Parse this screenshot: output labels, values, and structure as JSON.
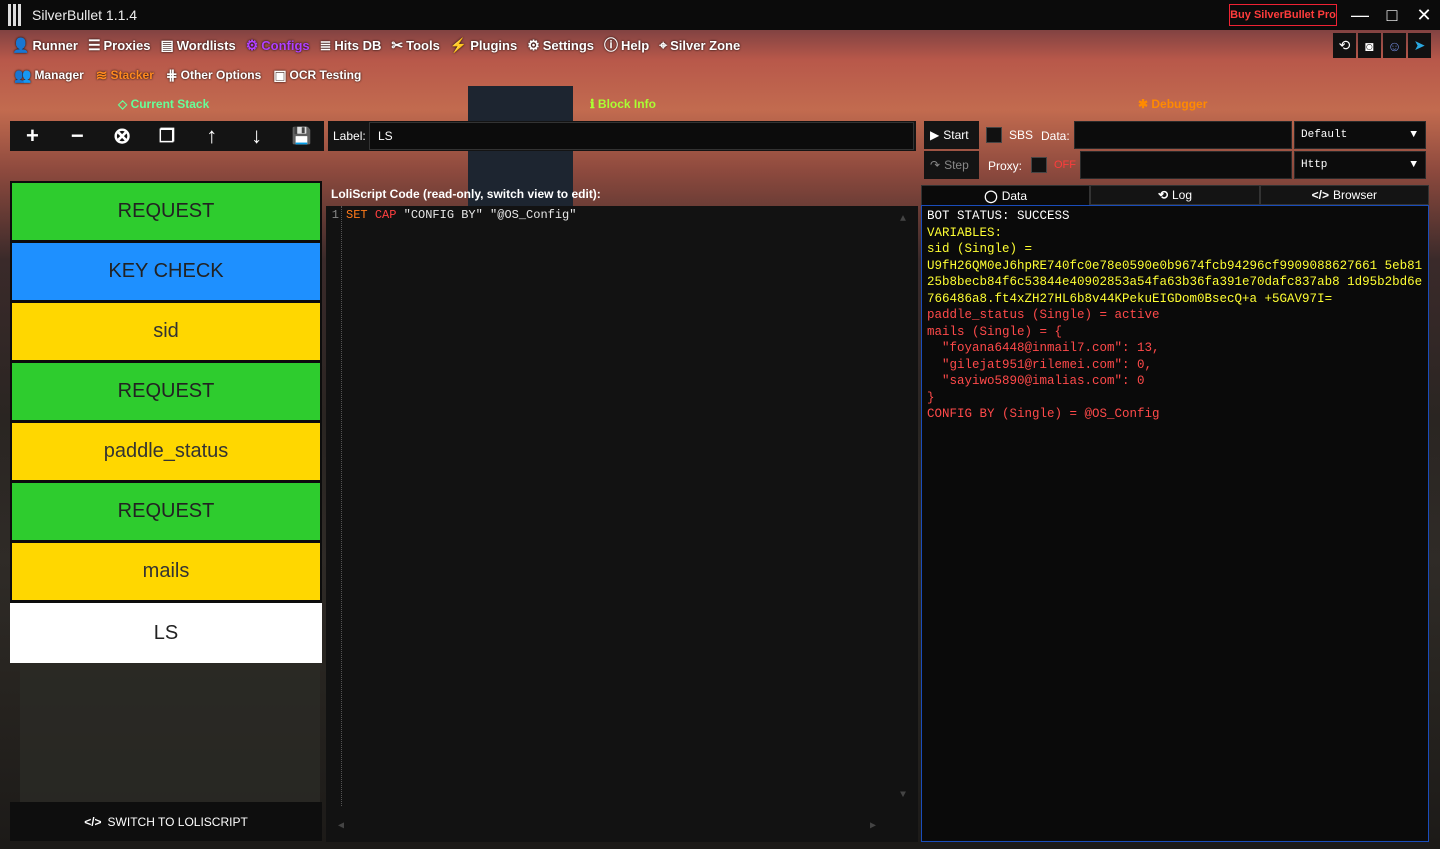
{
  "app": {
    "title": "SilverBullet 1.1.4",
    "buy_label": "Buy SilverBullet Pro"
  },
  "window_controls": {
    "minimize": "—",
    "maximize": "□",
    "close": "✕"
  },
  "nav_main": [
    {
      "label": "Runner",
      "icon": "runner-icon"
    },
    {
      "label": "Proxies",
      "icon": "server-icon"
    },
    {
      "label": "Wordlists",
      "icon": "document-icon"
    },
    {
      "label": "Configs",
      "icon": "gear-icon",
      "active": true
    },
    {
      "label": "Hits DB",
      "icon": "database-icon"
    },
    {
      "label": "Tools",
      "icon": "tools-icon"
    },
    {
      "label": "Plugins",
      "icon": "plug-icon"
    },
    {
      "label": "Settings",
      "icon": "cog-icon"
    },
    {
      "label": "Help",
      "icon": "help-icon"
    },
    {
      "label": "Silver Zone",
      "icon": "location-icon"
    }
  ],
  "nav_sub": [
    {
      "label": "Manager",
      "icon": "users-icon"
    },
    {
      "label": "Stacker",
      "icon": "stack-icon",
      "active": true
    },
    {
      "label": "Other Options",
      "icon": "sliders-icon"
    },
    {
      "label": "OCR Testing",
      "icon": "ocr-icon"
    }
  ],
  "sections": {
    "current_stack": "Current Stack",
    "block_info": "Block Info",
    "debugger": "Debugger"
  },
  "toolbar": {
    "add": "+",
    "remove": "−",
    "clear": "⊗",
    "clone": "❐",
    "up": "↑",
    "down": "↓",
    "save": "💾"
  },
  "label_field": {
    "label": "Label:",
    "value": "LS"
  },
  "blocks": [
    {
      "label": "REQUEST",
      "color": "green"
    },
    {
      "label": "KEY CHECK",
      "color": "blue"
    },
    {
      "label": "sid",
      "color": "yellow"
    },
    {
      "label": "REQUEST",
      "color": "green"
    },
    {
      "label": "paddle_status",
      "color": "yellow"
    },
    {
      "label": "REQUEST",
      "color": "green"
    },
    {
      "label": "mails",
      "color": "yellow"
    },
    {
      "label": "LS",
      "color": "white"
    }
  ],
  "switch_button": "SWITCH TO LOLISCRIPT",
  "code": {
    "title": "LoliScript Code (read-only, switch view to edit):",
    "line_number": "1",
    "tokens": {
      "kw1": "SET",
      "kw2": "CAP",
      "arg1": "\"CONFIG BY\"",
      "arg2": "\"@OS_Config\""
    }
  },
  "debugger": {
    "start": "Start",
    "step": "Step",
    "sbs": "SBS",
    "data_label": "Data:",
    "data_value": "",
    "wordlist_type": "Default",
    "proxy_label": "Proxy:",
    "proxy_state": "OFF",
    "proxy_value": "",
    "proxy_type": "Http"
  },
  "tabs": [
    {
      "label": "Data",
      "icon": "circle-icon",
      "active": true
    },
    {
      "label": "Log",
      "icon": "history-icon"
    },
    {
      "label": "Browser",
      "icon": "code-icon"
    }
  ],
  "output": [
    {
      "text": "BOT STATUS: SUCCESS",
      "color": "white"
    },
    {
      "text": "VARIABLES:",
      "color": "yellow"
    },
    {
      "text": "sid (Single) =",
      "color": "yellow"
    },
    {
      "text": "U9fH26QM0eJ6hpRE740fc0e78e0590e0b9674fcb94296cf9909088627661 5eb8125b8becb84f6c53844e40902853a54fa63b36fa391e70dafc837ab8 1d95b2bd6e766486a8.ft4xZH27HL6b8v44KPekuEIGDom0BsecQ+a +5GAV97I=",
      "color": "yellow"
    },
    {
      "text": "paddle_status (Single) = active",
      "color": "red"
    },
    {
      "text": "mails (Single) = {",
      "color": "red"
    },
    {
      "text": "  \"foyana6448@inmail7.com\": 13,",
      "color": "red"
    },
    {
      "text": "  \"gilejat951@rilemei.com\": 0,",
      "color": "red"
    },
    {
      "text": "  \"sayiwo5890@imalias.com\": 0",
      "color": "red"
    },
    {
      "text": "}",
      "color": "red"
    },
    {
      "text": "CONFIG BY (Single) = @OS_Config",
      "color": "red"
    }
  ]
}
